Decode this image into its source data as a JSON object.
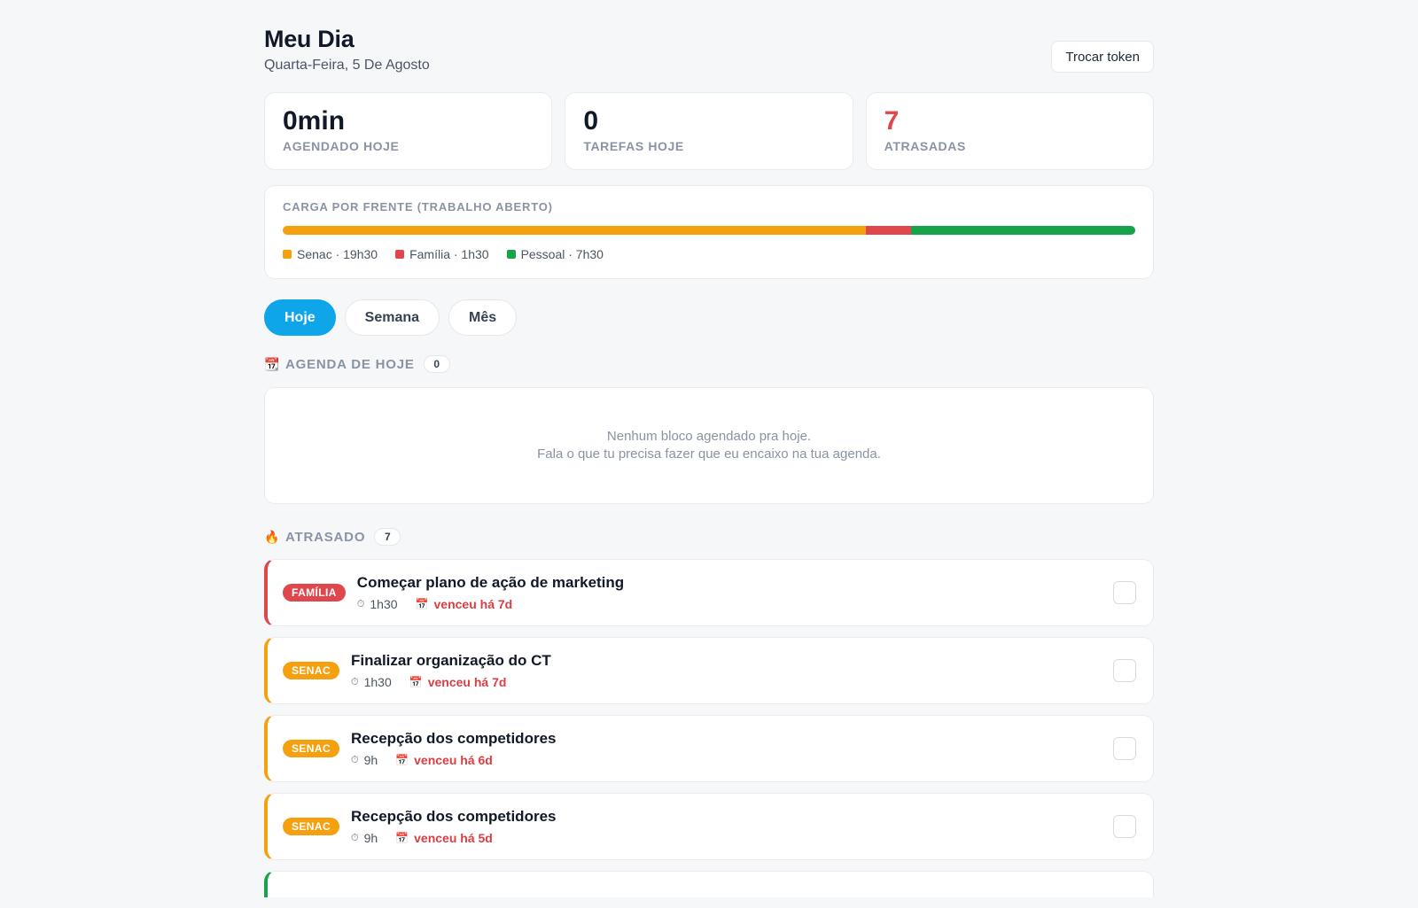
{
  "header": {
    "title": "Meu Dia",
    "subtitle": "Quarta-Feira, 5 De Agosto",
    "token_button": "Trocar token"
  },
  "stats": [
    {
      "value": "0min",
      "label": "AGENDADO HOJE"
    },
    {
      "value": "0",
      "label": "TAREFAS HOJE"
    },
    {
      "value": "7",
      "label": "ATRASADAS"
    }
  ],
  "load": {
    "title": "CARGA POR FRENTE (TRABALHO ABERTO)",
    "fronts": [
      {
        "label": "Senac · 19h30",
        "hours": 19.5,
        "color": "#f5a00f"
      },
      {
        "label": "Família · 1h30",
        "hours": 1.5,
        "color": "#e0474c"
      },
      {
        "label": "Pessoal · 7h30",
        "hours": 7.5,
        "color": "#16a34a"
      }
    ]
  },
  "tabs": [
    {
      "label": "Hoje",
      "active": true
    },
    {
      "label": "Semana",
      "active": false
    },
    {
      "label": "Mês",
      "active": false
    }
  ],
  "agenda": {
    "title": "AGENDA DE HOJE",
    "count": "0",
    "empty_line1": "Nenhum bloco agendado pra hoje.",
    "empty_line2": "Fala o que tu precisa fazer que eu encaixo na tua agenda."
  },
  "overdue": {
    "title": "ATRASADO",
    "count": "7",
    "tasks": [
      {
        "tag": "FAMÍLIA",
        "tag_color": "#e0474c",
        "title": "Começar plano de ação de marketing",
        "duration": "1h30",
        "due": "venceu há 7d"
      },
      {
        "tag": "SENAC",
        "tag_color": "#f5a00f",
        "title": "Finalizar organização do CT",
        "duration": "1h30",
        "due": "venceu há 7d"
      },
      {
        "tag": "SENAC",
        "tag_color": "#f5a00f",
        "title": "Recepção dos competidores",
        "duration": "9h",
        "due": "venceu há 6d"
      },
      {
        "tag": "SENAC",
        "tag_color": "#f5a00f",
        "title": "Recepção dos competidores",
        "duration": "9h",
        "due": "venceu há 5d"
      }
    ],
    "partial_color": "#16a34a"
  },
  "icons": {
    "agenda": "calendar-icon",
    "overdue": "fire-icon",
    "duration": "clock-icon",
    "due": "calendar-icon"
  }
}
